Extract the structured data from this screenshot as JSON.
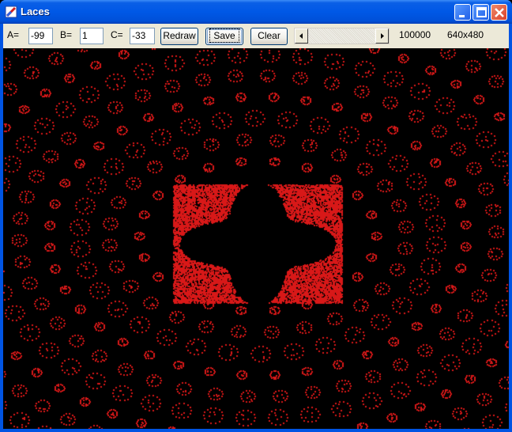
{
  "window": {
    "title": "Laces"
  },
  "toolbar": {
    "a_label": "A=",
    "a_value": "-99",
    "b_label": "B=",
    "b_value": "1",
    "c_label": "C=",
    "c_value": "-33",
    "redraw_label": "Redraw",
    "save_label": "Save",
    "clear_label": "Clear",
    "iterations": "100000",
    "resolution": "640x480"
  },
  "colors": {
    "plot": "#d81818",
    "background": "#000000"
  },
  "icons": {
    "app": "laces-app-icon",
    "minimize": "minimize-icon",
    "maximize": "maximize-icon",
    "close": "close-icon",
    "scroll_left": "arrow-left-icon",
    "scroll_right": "arrow-right-icon"
  }
}
